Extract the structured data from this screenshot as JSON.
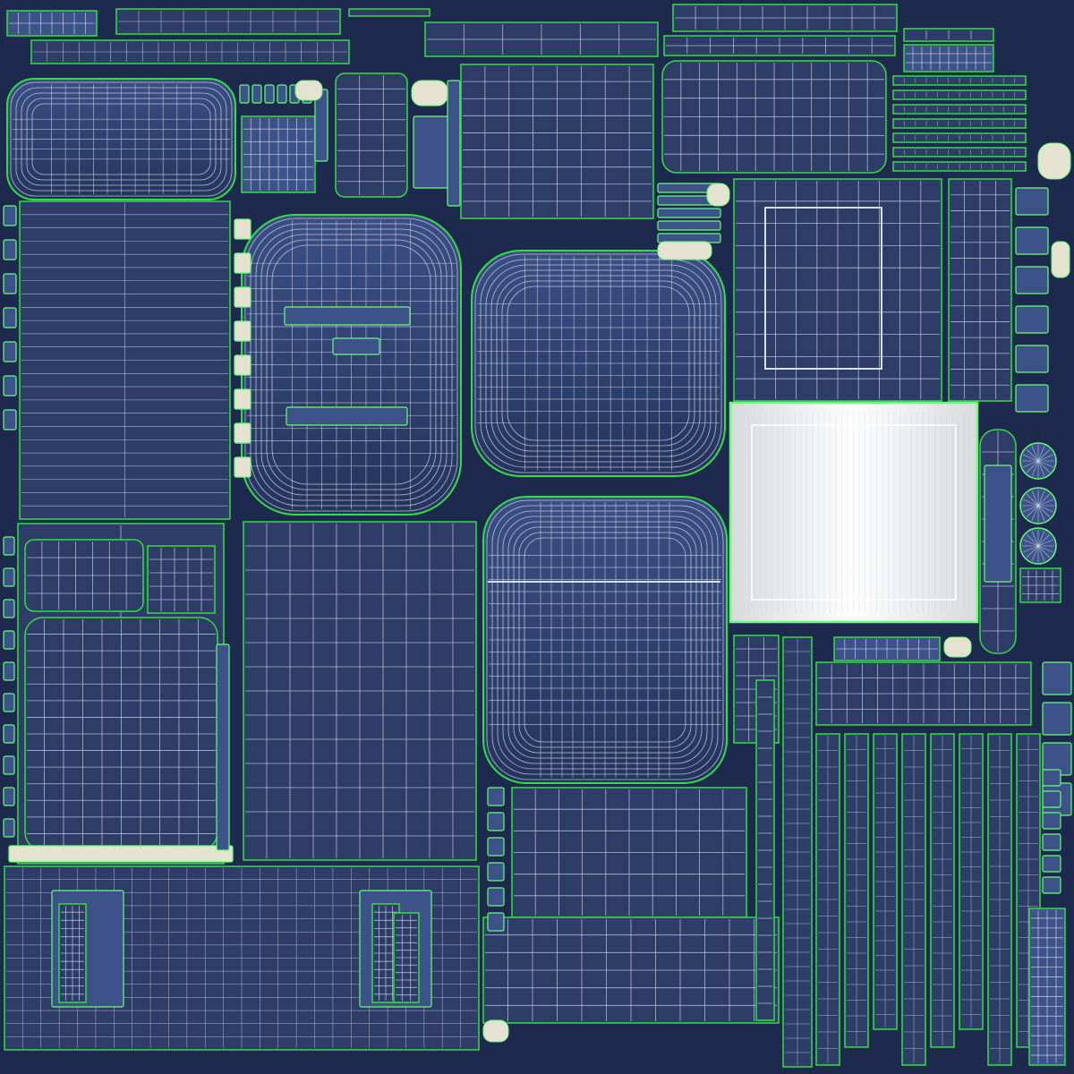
{
  "texture": {
    "colors": {
      "background": "#1d2a4d",
      "island_fill": "#2d3d68",
      "island_fill_light": "#3c5288",
      "grid_line": "#d8e0f0",
      "outline": "#33dd44",
      "outline_bright": "#66ff77",
      "white_panel": "#f2f4f6",
      "cream_part": "#e6e2d2"
    }
  }
}
